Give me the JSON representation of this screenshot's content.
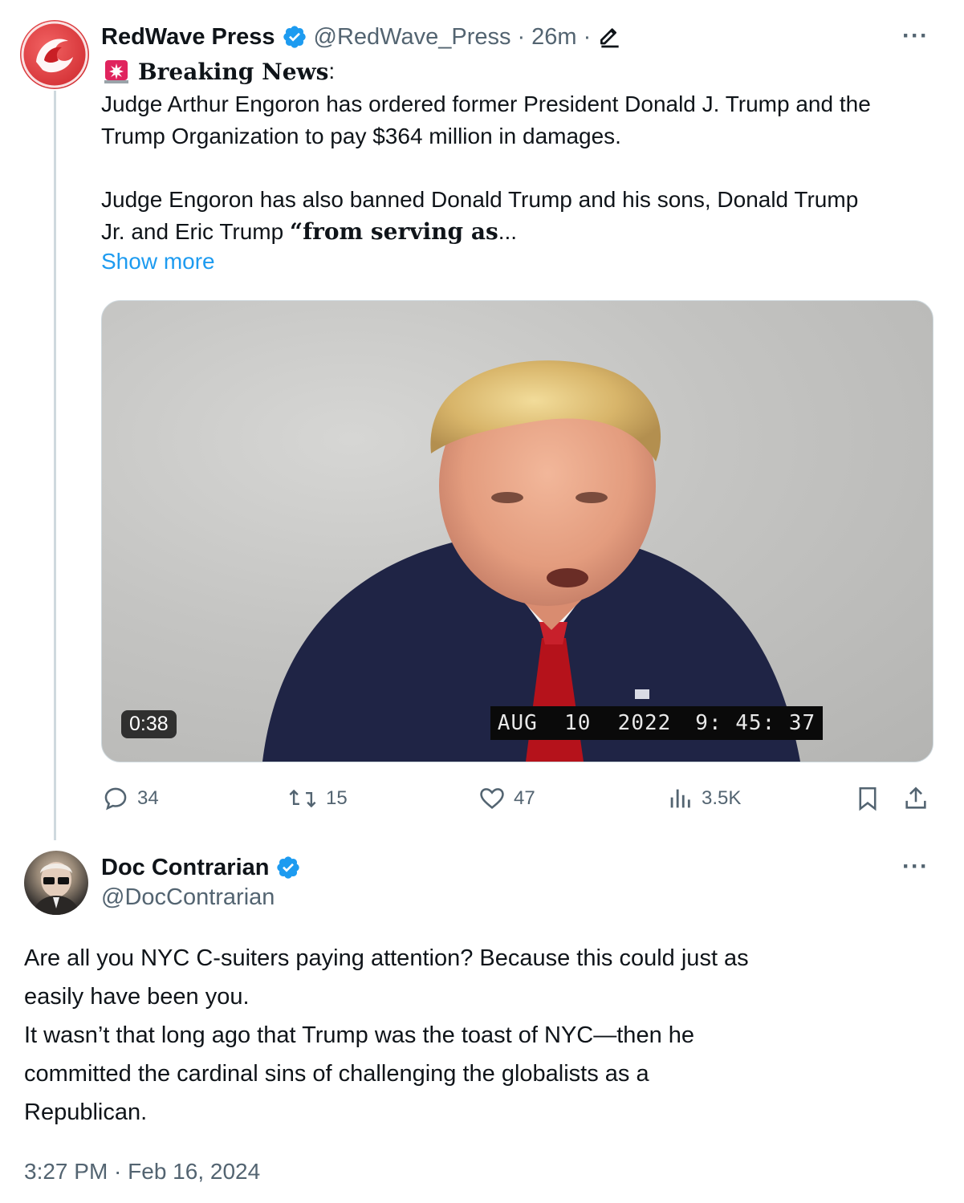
{
  "tweet": {
    "author": {
      "name": "RedWave Press",
      "handle": "@RedWave_Press",
      "time": "26m",
      "sep": "·",
      "verified_icon": "verified-badge-icon"
    },
    "breaking_label": "Breaking News",
    "breaking_colon": ":",
    "paragraph1": "Judge Arthur Engoron has ordered former President Donald J. Trump and the Trump Organization to pay $364 million in damages.",
    "paragraph2_line1": "Judge Engoron has also banned Donald Trump and his sons, Donald Trump",
    "paragraph2_line2_plain": "Jr. and Eric Trump ",
    "paragraph2_line2_bold": "“from serving as",
    "paragraph2_ellipsis": "...",
    "show_more": "Show more",
    "more_menu": "···",
    "video": {
      "duration": "0:38",
      "overlay_date": "AUG  10  2022",
      "overlay_time": "9: 45: 37"
    },
    "actions": {
      "replies": "34",
      "reposts": "15",
      "likes": "47",
      "views": "3.5K"
    }
  },
  "reply": {
    "author": {
      "name": "Doc Contrarian",
      "handle": "@DocContrarian",
      "verified_icon": "verified-badge-icon"
    },
    "more_menu": "···",
    "text_lines": [
      "Are all you NYC C-suiters paying attention? Because this could just as",
      "easily have been you.",
      "It wasn’t that long ago that Trump was the toast of NYC—then he",
      "committed the cardinal sins of challenging the globalists as a",
      "Republican."
    ],
    "timestamp": "3:27 PM · Feb 16, 2024"
  },
  "colors": {
    "accent": "#1d9bf0",
    "muted": "#536471",
    "text": "#0f1419",
    "brand_red": "#d7262b"
  }
}
